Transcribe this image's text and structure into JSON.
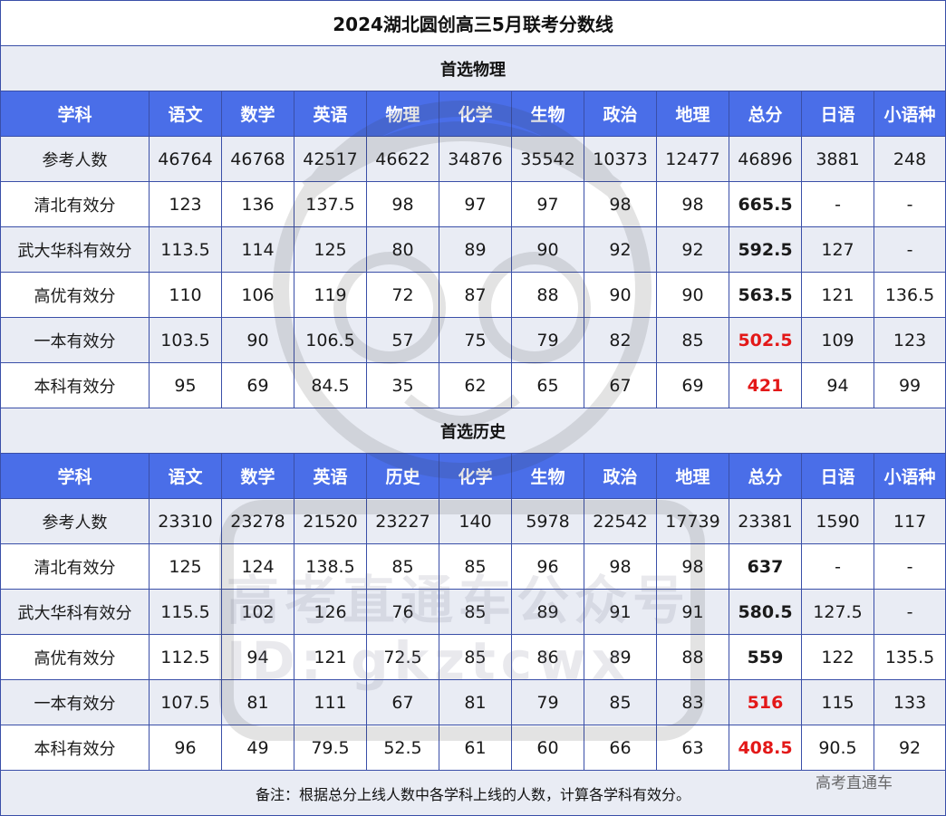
{
  "title": "2024湖北圆创高三5月联考分数线",
  "note": "备注：根据总分上线人数中各学科上线的人数，计算各学科有效分。",
  "watermark": {
    "corner_text": "高考直通车",
    "big_line1": "高考直通车公众号",
    "big_line2": "ID: gkztcwx"
  },
  "colors": {
    "header": "#4a6ee8",
    "shade": "#e9ecf4",
    "highlight_red": "#e31818",
    "border": "#3a4fa8"
  },
  "sections": [
    {
      "name": "首选物理",
      "headers": [
        "学科",
        "语文",
        "数学",
        "英语",
        "物理",
        "化学",
        "生物",
        "政治",
        "地理",
        "总分",
        "日语",
        "小语种"
      ],
      "rows": [
        {
          "label": "参考人数",
          "values": [
            "46764",
            "46768",
            "42517",
            "46622",
            "34876",
            "35542",
            "10373",
            "12477",
            "46896",
            "3881",
            "248"
          ],
          "total_style": "normal"
        },
        {
          "label": "清北有效分",
          "values": [
            "123",
            "136",
            "137.5",
            "98",
            "97",
            "97",
            "98",
            "98",
            "665.5",
            "-",
            "-"
          ],
          "total_style": "bold"
        },
        {
          "label": "武大华科有效分",
          "values": [
            "113.5",
            "114",
            "125",
            "80",
            "89",
            "90",
            "92",
            "92",
            "592.5",
            "127",
            "-"
          ],
          "total_style": "bold"
        },
        {
          "label": "高优有效分",
          "values": [
            "110",
            "106",
            "119",
            "72",
            "87",
            "88",
            "90",
            "90",
            "563.5",
            "121",
            "136.5"
          ],
          "total_style": "bold"
        },
        {
          "label": "一本有效分",
          "values": [
            "103.5",
            "90",
            "106.5",
            "57",
            "75",
            "79",
            "82",
            "85",
            "502.5",
            "109",
            "123"
          ],
          "total_style": "red"
        },
        {
          "label": "本科有效分",
          "values": [
            "95",
            "69",
            "84.5",
            "35",
            "62",
            "65",
            "67",
            "69",
            "421",
            "94",
            "99"
          ],
          "total_style": "red"
        }
      ]
    },
    {
      "name": "首选历史",
      "headers": [
        "学科",
        "语文",
        "数学",
        "英语",
        "历史",
        "化学",
        "生物",
        "政治",
        "地理",
        "总分",
        "日语",
        "小语种"
      ],
      "rows": [
        {
          "label": "参考人数",
          "values": [
            "23310",
            "23278",
            "21520",
            "23227",
            "140",
            "5978",
            "22542",
            "17739",
            "23381",
            "1590",
            "117"
          ],
          "total_style": "normal"
        },
        {
          "label": "清北有效分",
          "values": [
            "125",
            "124",
            "138.5",
            "85",
            "85",
            "96",
            "98",
            "98",
            "637",
            "-",
            "-"
          ],
          "total_style": "bold"
        },
        {
          "label": "武大华科有效分",
          "values": [
            "115.5",
            "102",
            "126",
            "76",
            "85",
            "89",
            "91",
            "91",
            "580.5",
            "127.5",
            "-"
          ],
          "total_style": "bold"
        },
        {
          "label": "高优有效分",
          "values": [
            "112.5",
            "94",
            "121",
            "72.5",
            "85",
            "86",
            "89",
            "88",
            "559",
            "122",
            "135.5"
          ],
          "total_style": "bold"
        },
        {
          "label": "一本有效分",
          "values": [
            "107.5",
            "81",
            "111",
            "67",
            "81",
            "79",
            "85",
            "83",
            "516",
            "115",
            "133"
          ],
          "total_style": "red"
        },
        {
          "label": "本科有效分",
          "values": [
            "96",
            "49",
            "79.5",
            "52.5",
            "61",
            "60",
            "66",
            "63",
            "408.5",
            "90.5",
            "92"
          ],
          "total_style": "red"
        }
      ]
    }
  ]
}
